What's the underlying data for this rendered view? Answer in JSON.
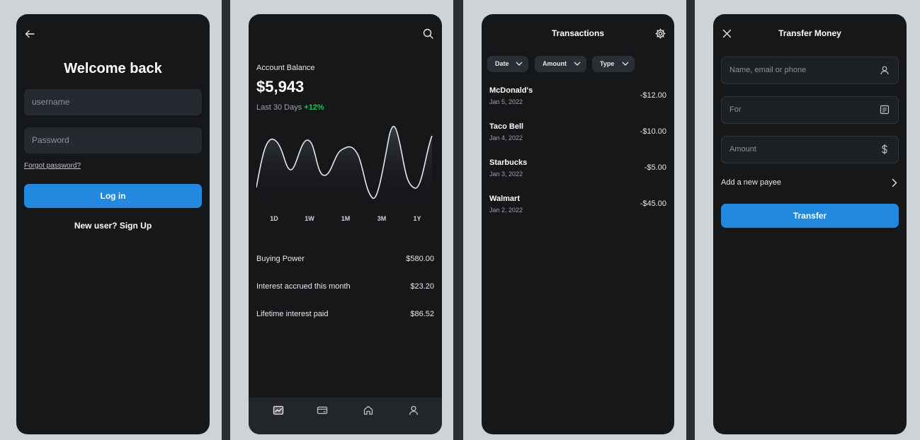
{
  "login": {
    "title": "Welcome back",
    "username_placeholder": "username",
    "password_placeholder": "Password",
    "forgot_label": "Forgot password?",
    "login_label": "Log in",
    "signup_label": "New user? Sign Up"
  },
  "account": {
    "balance_label": "Account Balance",
    "balance_value": "$5,943",
    "period_label": "Last 30 Days",
    "period_change": "+12%",
    "ranges": [
      "1D",
      "1W",
      "1M",
      "3M",
      "1Y"
    ],
    "stats": [
      {
        "label": "Buying Power",
        "value": "$580.00"
      },
      {
        "label": "Interest accrued this month",
        "value": "$23.20"
      },
      {
        "label": "Lifetime interest paid",
        "value": "$86.52"
      }
    ],
    "nav": [
      "chart-icon",
      "card-icon",
      "home-icon",
      "user-icon"
    ]
  },
  "transactions": {
    "title": "Transactions",
    "filters": [
      "Date",
      "Amount",
      "Type"
    ],
    "items": [
      {
        "name": "McDonald's",
        "date": "Jan 5, 2022",
        "amount": "-$12.00"
      },
      {
        "name": "Taco Bell",
        "date": "Jan 4, 2022",
        "amount": "-$10.00"
      },
      {
        "name": "Starbucks",
        "date": "Jan 3, 2022",
        "amount": "-$5.00"
      },
      {
        "name": "Walmart",
        "date": "Jan 2, 2022",
        "amount": "-$45.00"
      }
    ]
  },
  "transfer": {
    "title": "Transfer Money",
    "recipient_placeholder": "Name, email or phone",
    "for_placeholder": "For",
    "amount_placeholder": "Amount",
    "payee_label": "Add a new payee",
    "transfer_label": "Transfer"
  },
  "colors": {
    "accent": "#2389de",
    "positive": "#21c45d",
    "screen_bg": "#151719"
  }
}
